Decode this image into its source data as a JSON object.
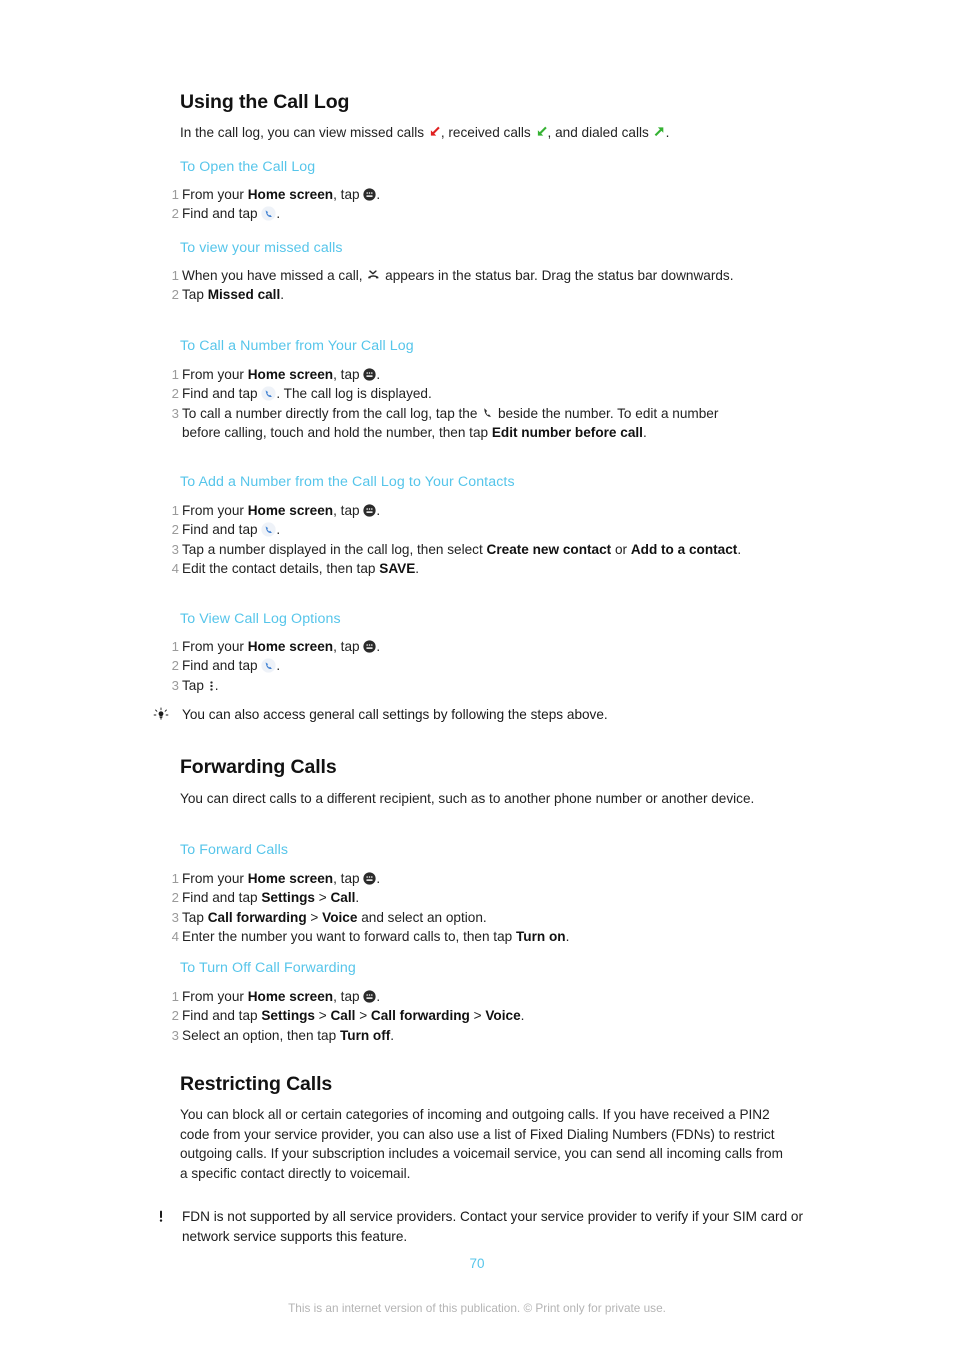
{
  "page": {
    "number": "70",
    "footer_note": "This is an internet version of this publication. © Print only for private use."
  },
  "sections": [
    {
      "title": "Using the Call Log",
      "intro_parts": {
        "p1": "In the call log, you can view missed calls ",
        "p2": ", received calls ",
        "p3": ", and dialed calls ",
        "p4": "."
      },
      "subsections": [
        {
          "heading": "To Open the Call Log",
          "steps": [
            {
              "a": "From your ",
              "b": "Home screen",
              "c": ", tap ",
              "d": "."
            },
            {
              "a": "Find and tap ",
              "d": "."
            }
          ]
        },
        {
          "heading": "To view your missed calls",
          "steps": [
            {
              "a": "When you have missed a call, ",
              "d": " appears in the status bar. Drag the status bar downwards."
            },
            {
              "a": "Tap ",
              "b": "Missed call",
              "d": "."
            }
          ]
        },
        {
          "heading": "To Call a Number from Your Call Log",
          "steps": [
            {
              "a": "From your ",
              "b": "Home screen",
              "c": ", tap ",
              "d": "."
            },
            {
              "a": "Find and tap ",
              "d": ". The call log is displayed."
            },
            {
              "a": "To call a number directly from the call log, tap the ",
              "d": " beside the number. To edit a number before calling, touch and hold the number, then tap ",
              "b": "Edit number before call",
              "c": "."
            }
          ]
        },
        {
          "heading": "To Add a Number from the Call Log to Your Contacts",
          "steps": [
            {
              "a": "From your ",
              "b": "Home screen",
              "c": ", tap ",
              "d": "."
            },
            {
              "a": "Find and tap ",
              "d": "."
            },
            {
              "a": "Tap a number displayed in the call log, then select ",
              "b": "Create new contact",
              "c": " or ",
              "e": "Add to a contact",
              "f": "."
            },
            {
              "a": "Edit the contact details, then tap ",
              "b": "SAVE",
              "c": "."
            }
          ]
        },
        {
          "heading": "To View Call Log Options",
          "steps": [
            {
              "a": "From your ",
              "b": "Home screen",
              "c": ", tap ",
              "d": "."
            },
            {
              "a": "Find and tap ",
              "d": "."
            },
            {
              "a": "Tap ",
              "d": "."
            }
          ]
        }
      ],
      "tip": {
        "icon": "lightbulb-icon",
        "text": "You can also access general call settings by following the steps above."
      }
    },
    {
      "title": "Forwarding Calls",
      "intro": "You can direct calls to a different recipient, such as to another phone number or another device.",
      "subsections": [
        {
          "heading": "To Forward Calls",
          "steps": [
            {
              "a": "From your ",
              "b": "Home screen",
              "c": ", tap ",
              "d": "."
            },
            {
              "a": "Find and tap ",
              "b": "Settings",
              "c": " > ",
              "e": "Call",
              "f": "."
            },
            {
              "a": "Tap ",
              "b": "Call forwarding",
              "c": " > ",
              "e": "Voice",
              "f": " and select an option."
            },
            {
              "a": "Enter the number you want to forward calls to, then tap ",
              "b": "Turn on",
              "c": "."
            }
          ]
        },
        {
          "heading": "To Turn Off Call Forwarding",
          "steps": [
            {
              "a": "From your ",
              "b": "Home screen",
              "c": ", tap ",
              "d": "."
            },
            {
              "a": "Find and tap ",
              "b": "Settings",
              "c": " > ",
              "e": "Call",
              "f": " > ",
              "g": "Call forwarding",
              "h": " > ",
              "i": "Voice",
              "j": "."
            },
            {
              "a": "Select an option, then tap ",
              "b": "Turn off",
              "c": "."
            }
          ]
        }
      ]
    },
    {
      "title": "Restricting Calls",
      "intro": "You can block all or certain categories of incoming and outgoing calls. If you have received a PIN2 code from your service provider, you can also use a list of Fixed Dialing Numbers (FDNs) to restrict outgoing calls. If your subscription includes a voicemail service, you can send all incoming calls from a specific contact directly to voicemail.",
      "warning": {
        "icon": "exclamation-icon",
        "text": "FDN is not supported by all service providers. Contact your service provider to verify if your SIM card or network service supports this feature."
      }
    }
  ],
  "icons": {
    "missed_call_arrow": "arrow-down-left-red-icon",
    "received_call_arrow": "arrow-down-left-green-icon",
    "dialed_call_arrow": "arrow-up-right-green-icon",
    "app_drawer": "app-drawer-icon",
    "dialer": "dialer-phone-icon",
    "status_missed": "missed-call-status-icon",
    "handset": "phone-handset-icon",
    "overflow": "overflow-menu-icon"
  },
  "colors": {
    "heading_blue": "#56c5ea",
    "missed_red": "#e02020",
    "received_green": "#35b233",
    "dialed_green": "#35b233",
    "step_number_gray": "#9a9a9a",
    "footer_gray": "#b4b4b4",
    "dialer_blue": "#3f7fd0"
  }
}
